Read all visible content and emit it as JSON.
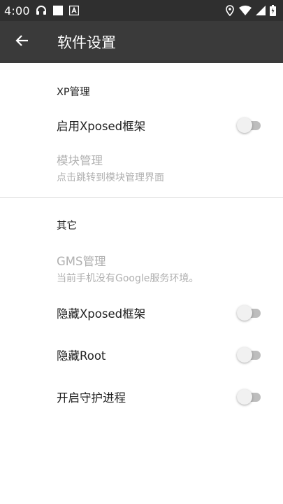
{
  "status_bar": {
    "time": "4:00",
    "icons_left": [
      "headphones-icon",
      "white-square-icon",
      "a-box-icon"
    ],
    "icons_right": [
      "location-icon",
      "wifi-icon",
      "signal-icon",
      "battery-icon"
    ]
  },
  "app_bar": {
    "title": "软件设置",
    "back_icon": "arrow-left-icon"
  },
  "sections": {
    "xp": {
      "header": "XP管理",
      "enable_xposed": {
        "title": "启用Xposed框架",
        "checked": false
      },
      "module_manage": {
        "title": "模块管理",
        "summary": "点击跳转到模块管理界面"
      }
    },
    "other": {
      "header": "其它",
      "gms": {
        "title": "GMS管理",
        "summary": "当前手机没有Google服务环境。"
      },
      "hide_xposed": {
        "title": "隐藏Xposed框架",
        "checked": false
      },
      "hide_root": {
        "title": "隐藏Root",
        "checked": false
      },
      "guard_process": {
        "title": "开启守护进程",
        "checked": false
      }
    }
  },
  "colors": {
    "status_bar_bg": "#2f2f2f",
    "app_bar_bg": "#3a3a3a",
    "disabled_text": "#b0b0b0",
    "switch_track": "#bdbdbd"
  }
}
